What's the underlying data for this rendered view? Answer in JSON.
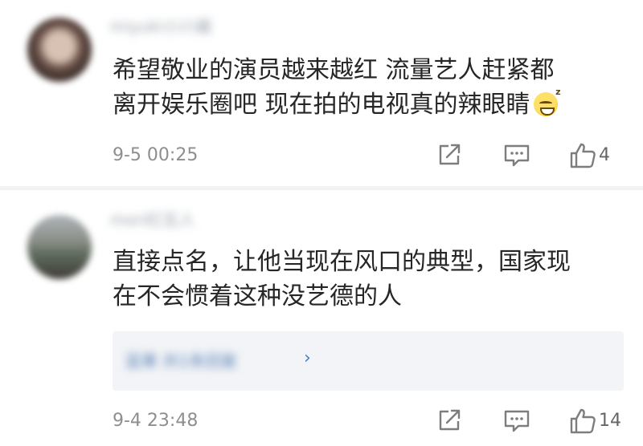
{
  "comments": [
    {
      "username": "miyuki小川酱",
      "text": "希望敬业的演员越来越红 流量艺人赶紧都\n离开娱乐圈吧 现在拍的电视真的辣眼睛",
      "emoji": "sleepy-grin-emoji",
      "timestamp": "9-5 00:25",
      "likes": "4"
    },
    {
      "username": "mori红瓦人",
      "text": "直接点名，让他当现在风口的典型，国家现\n在不会惯着这种没艺德的人",
      "reply_preview": "蓝果 共1条回复",
      "timestamp": "9-4 23:48",
      "likes": "14"
    }
  ],
  "icons": {
    "share": "share-icon",
    "reply": "comment-icon",
    "like": "thumbs-up-icon",
    "reply_more": "chevron-right-icon"
  },
  "colors": {
    "text": "#262626",
    "meta": "#8e8e8e",
    "link": "#4a7ec4",
    "reply_bg": "#f2f4f7"
  }
}
